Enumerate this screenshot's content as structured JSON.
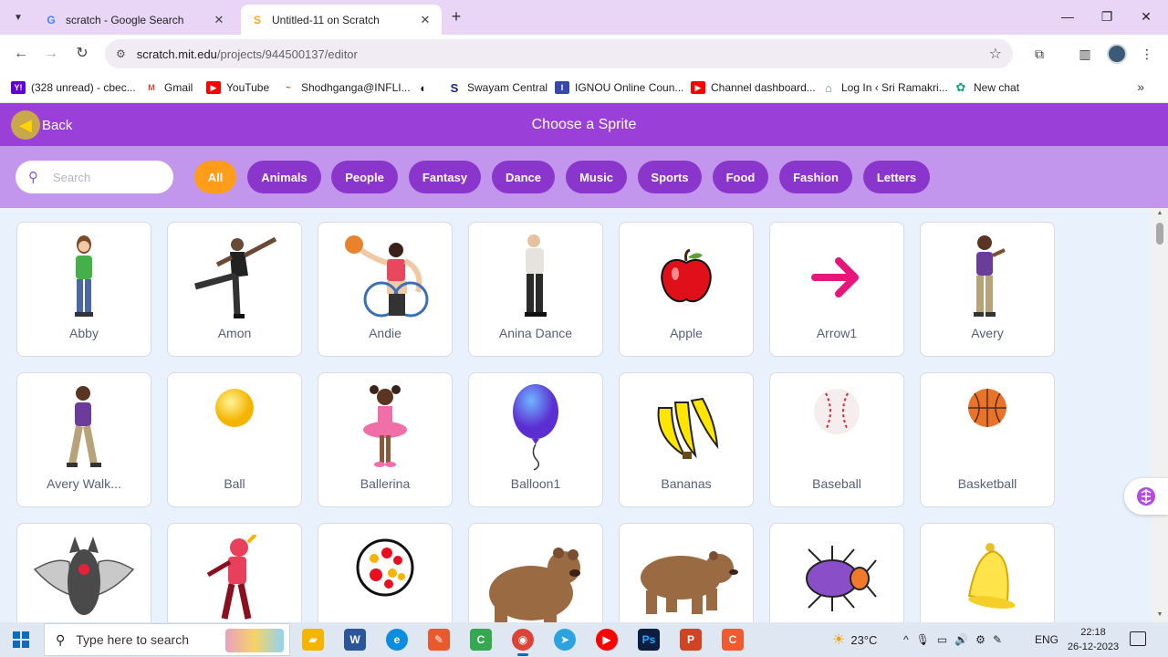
{
  "browser": {
    "tabs": [
      {
        "title": "scratch - Google Search",
        "favicon": "G",
        "active": false
      },
      {
        "title": "Untitled-11 on Scratch",
        "favicon": "S",
        "active": true
      }
    ],
    "url_host": "scratch.mit.edu",
    "url_path": "/projects/944500137/editor",
    "bookmarks": [
      {
        "label": "(328 unread) - cbec...",
        "icon": "Y!",
        "color": "#6001d2"
      },
      {
        "label": "Gmail",
        "icon": "M",
        "color": "#ea4335"
      },
      {
        "label": "YouTube",
        "icon": "▶",
        "color": "#ff0000"
      },
      {
        "label": "Shodhganga@INFLI...",
        "icon": "~",
        "color": "#d84315"
      },
      {
        "label": "",
        "icon": "◐",
        "color": "#222222"
      },
      {
        "label": "Swayam Central",
        "icon": "S",
        "color": "#1a237e"
      },
      {
        "label": "IGNOU Online Coun...",
        "icon": "I",
        "color": "#3949ab"
      },
      {
        "label": "Channel dashboard...",
        "icon": "▶",
        "color": "#ff0000"
      },
      {
        "label": "Log In ‹ Sri Ramakri...",
        "icon": "⌂",
        "color": "#607d8b"
      },
      {
        "label": "New chat",
        "icon": "✿",
        "color": "#10a37f"
      }
    ]
  },
  "library": {
    "back_label": "Back",
    "title": "Choose a Sprite",
    "search_placeholder": "Search",
    "tags": [
      "All",
      "Animals",
      "People",
      "Fantasy",
      "Dance",
      "Music",
      "Sports",
      "Food",
      "Fashion",
      "Letters"
    ],
    "selected_tag": "All",
    "sprites": [
      {
        "name": "Abby",
        "art": "girl"
      },
      {
        "name": "Amon",
        "art": "dancer"
      },
      {
        "name": "Andie",
        "art": "wheelchair"
      },
      {
        "name": "Anina Dance",
        "art": "man"
      },
      {
        "name": "Apple",
        "art": "apple"
      },
      {
        "name": "Arrow1",
        "art": "arrow"
      },
      {
        "name": "Avery",
        "art": "avery"
      },
      {
        "name": "Avery Walk...",
        "art": "avery"
      },
      {
        "name": "Ball",
        "art": "ball"
      },
      {
        "name": "Ballerina",
        "art": "ballerina"
      },
      {
        "name": "Balloon1",
        "art": "balloon"
      },
      {
        "name": "Bananas",
        "art": "bananas"
      },
      {
        "name": "Baseball",
        "art": "baseball"
      },
      {
        "name": "Basketball",
        "art": "basketball"
      },
      {
        "name": "",
        "art": "bat"
      },
      {
        "name": "",
        "art": "batter"
      },
      {
        "name": "",
        "art": "dots"
      },
      {
        "name": "",
        "art": "bear"
      },
      {
        "name": "",
        "art": "bear2"
      },
      {
        "name": "",
        "art": "beetle"
      },
      {
        "name": "",
        "art": "bell"
      }
    ]
  },
  "taskbar": {
    "search_text": "Type here to search",
    "weather": "23°C",
    "language": "ENG",
    "time": "22:18",
    "date": "26-12-2023",
    "apps": [
      {
        "name": "file-explorer",
        "color": "#f4b400",
        "glyph": "▰"
      },
      {
        "name": "word",
        "color": "#2b579a",
        "glyph": "W"
      },
      {
        "name": "edge",
        "color": "#0c8de0",
        "glyph": "e"
      },
      {
        "name": "paint",
        "color": "#e85a2c",
        "glyph": "✎"
      },
      {
        "name": "camtasia",
        "color": "#36a852",
        "glyph": "C"
      },
      {
        "name": "chrome",
        "color": "#db4437",
        "glyph": "◉"
      },
      {
        "name": "telegram",
        "color": "#2aa3e0",
        "glyph": "➤"
      },
      {
        "name": "youtube",
        "color": "#ff0000",
        "glyph": "▶"
      },
      {
        "name": "photoshop",
        "color": "#0b1e3f",
        "glyph": "Ps"
      },
      {
        "name": "powerpoint",
        "color": "#d04423",
        "glyph": "P"
      },
      {
        "name": "camtasia-recorder",
        "color": "#ef5b2e",
        "glyph": "C"
      }
    ]
  }
}
